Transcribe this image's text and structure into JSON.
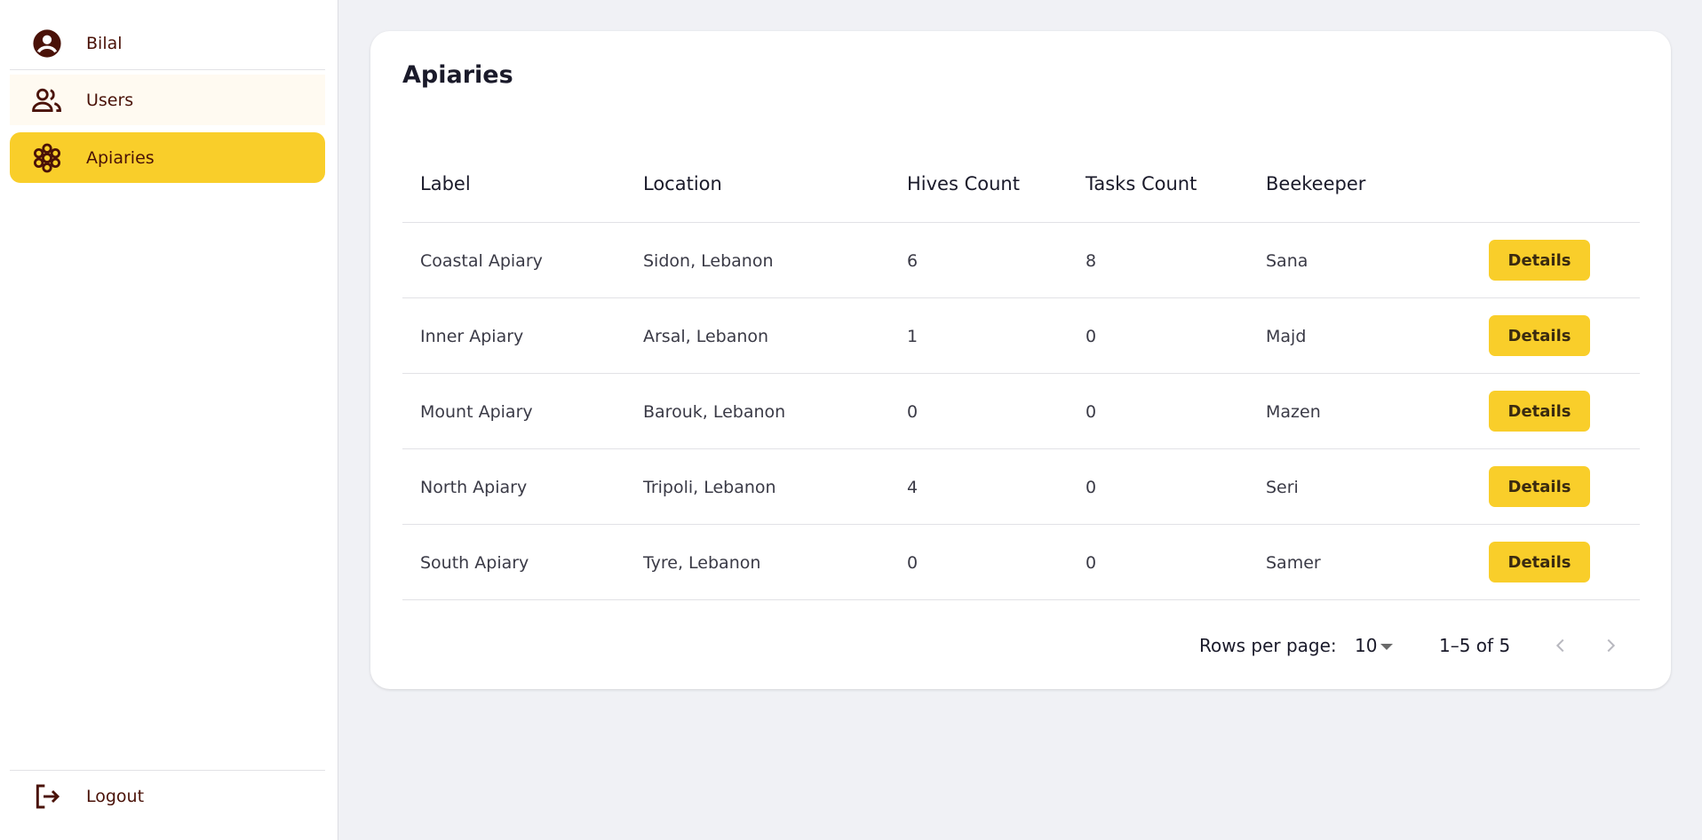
{
  "sidebar": {
    "profile_label": "Bilal",
    "items": [
      {
        "label": "Users",
        "icon": "users-icon"
      },
      {
        "label": "Apiaries",
        "icon": "honeycomb-icon"
      }
    ],
    "logout_label": "Logout",
    "active_color": "#f9ce2a",
    "text_color": "#4a1208"
  },
  "main": {
    "title": "Apiaries",
    "table": {
      "columns": [
        "Label",
        "Location",
        "Hives Count",
        "Tasks Count",
        "Beekeeper"
      ],
      "rows": [
        {
          "label": "Coastal Apiary",
          "location": "Sidon, Lebanon",
          "hives": "6",
          "tasks": "8",
          "beekeeper": "Sana",
          "action": "Details"
        },
        {
          "label": "Inner Apiary",
          "location": "Arsal, Lebanon",
          "hives": "1",
          "tasks": "0",
          "beekeeper": "Majd",
          "action": "Details"
        },
        {
          "label": "Mount Apiary",
          "location": "Barouk, Lebanon",
          "hives": "0",
          "tasks": "0",
          "beekeeper": "Mazen",
          "action": "Details"
        },
        {
          "label": "North Apiary",
          "location": "Tripoli, Lebanon",
          "hives": "4",
          "tasks": "0",
          "beekeeper": "Seri",
          "action": "Details"
        },
        {
          "label": "South Apiary",
          "location": "Tyre, Lebanon",
          "hives": "0",
          "tasks": "0",
          "beekeeper": "Samer",
          "action": "Details"
        }
      ]
    },
    "pagination": {
      "rows_per_page_label": "Rows per page:",
      "rows_per_page_value": "10",
      "range_text": "1–5 of 5"
    }
  }
}
